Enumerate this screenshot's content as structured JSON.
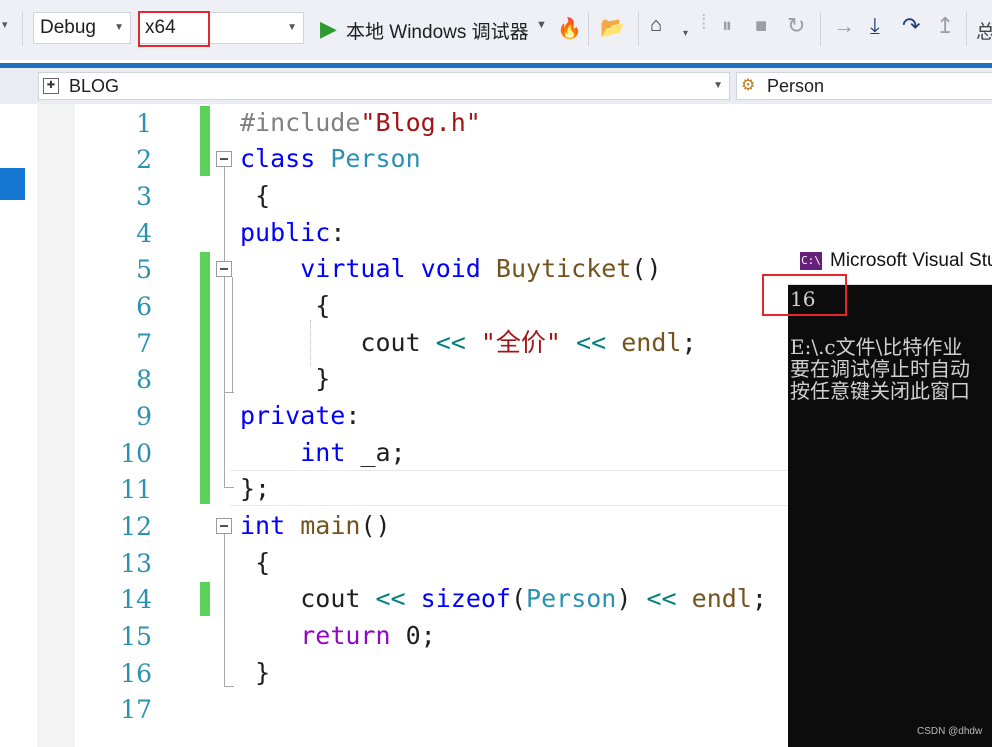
{
  "toolbar": {
    "config": "Debug",
    "platform": "x64",
    "run_label": "本地 Windows 调试器",
    "partial_char": "总"
  },
  "navbar": {
    "project": "BLOG",
    "class_scope": "Person"
  },
  "line_numbers": [
    "1",
    "2",
    "3",
    "4",
    "5",
    "6",
    "7",
    "8",
    "9",
    "10",
    "11",
    "12",
    "13",
    "14",
    "15",
    "16",
    "17"
  ],
  "code": {
    "l1": {
      "pre": "#include",
      "str": "\"Blog.h\""
    },
    "l2": {
      "kw": "class",
      "ty": "Person"
    },
    "l3": "{",
    "l4": {
      "kw": "public",
      "rest": ":"
    },
    "l5": {
      "kw1": "virtual",
      "kw2": "void",
      "fn": "Buyticket",
      "rest": "()"
    },
    "l6": "{",
    "l7": {
      "a": "cout",
      "op1": "<<",
      "str": "\"全价\"",
      "op2": "<<",
      "b": "endl",
      "end": ";"
    },
    "l8": "}",
    "l9": {
      "kw": "private",
      "rest": ":"
    },
    "l10": {
      "kw": "int",
      "rest": "_a;"
    },
    "l11": "};",
    "l12": {
      "kw": "int",
      "fn": "main",
      "rest": "()"
    },
    "l13": "{",
    "l14": {
      "a": "cout",
      "op1": "<<",
      "kw": "sizeof",
      "p1": "(",
      "ty": "Person",
      "p2": ")",
      "op2": "<<",
      "b": "endl",
      "end": ";"
    },
    "l15": {
      "kw": "return",
      "rest": "0;"
    },
    "l16": "}"
  },
  "console": {
    "title": "Microsoft Visual Stu",
    "icon_text": "C:\\",
    "output": "16",
    "line1": "E:\\.c文件\\比特作业",
    "line2": "要在调试停止时自动",
    "line3": "按任意键关闭此窗口"
  },
  "watermark": "CSDN @dhdw",
  "colors": {
    "keyword": "#0000ff",
    "type": "#2b91af",
    "string": "#a31515",
    "change_marker": "#5bd35b",
    "highlight_box": "#e2272d"
  }
}
